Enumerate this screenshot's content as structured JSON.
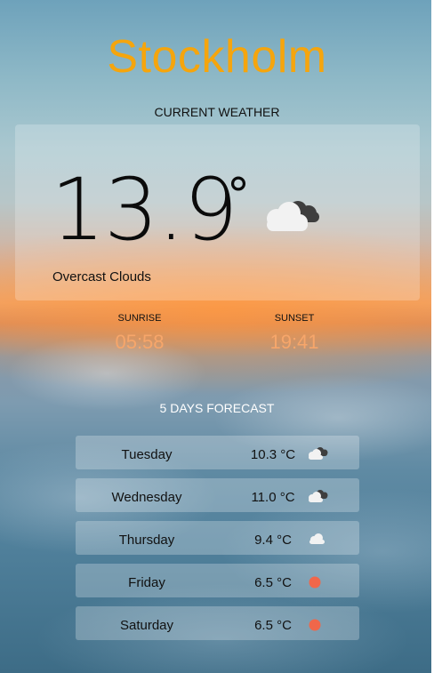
{
  "city": "Stockholm",
  "current": {
    "section_title": "CURRENT WEATHER",
    "temperature": "13.9",
    "degree_symbol": "°",
    "description": "Overcast Clouds",
    "icon": "overcast-clouds-icon"
  },
  "sun": {
    "sunrise_label": "SUNRISE",
    "sunrise_time": "05:58",
    "sunset_label": "SUNSET",
    "sunset_time": "19:41"
  },
  "forecast": {
    "section_title": "5 DAYS FORECAST",
    "days": [
      {
        "day": "Tuesday",
        "temp": "10.3 °C",
        "icon": "broken-clouds-icon"
      },
      {
        "day": "Wednesday",
        "temp": "11.0 °C",
        "icon": "broken-clouds-icon"
      },
      {
        "day": "Thursday",
        "temp": "9.4 °C",
        "icon": "cloud-icon"
      },
      {
        "day": "Friday",
        "temp": "6.5 °C",
        "icon": "sun-icon"
      },
      {
        "day": "Saturday",
        "temp": "6.5 °C",
        "icon": "sun-icon"
      }
    ]
  },
  "colors": {
    "city": "#f5a50d",
    "sun_times": "#f7a66a",
    "sun_icon": "#f0674a"
  }
}
